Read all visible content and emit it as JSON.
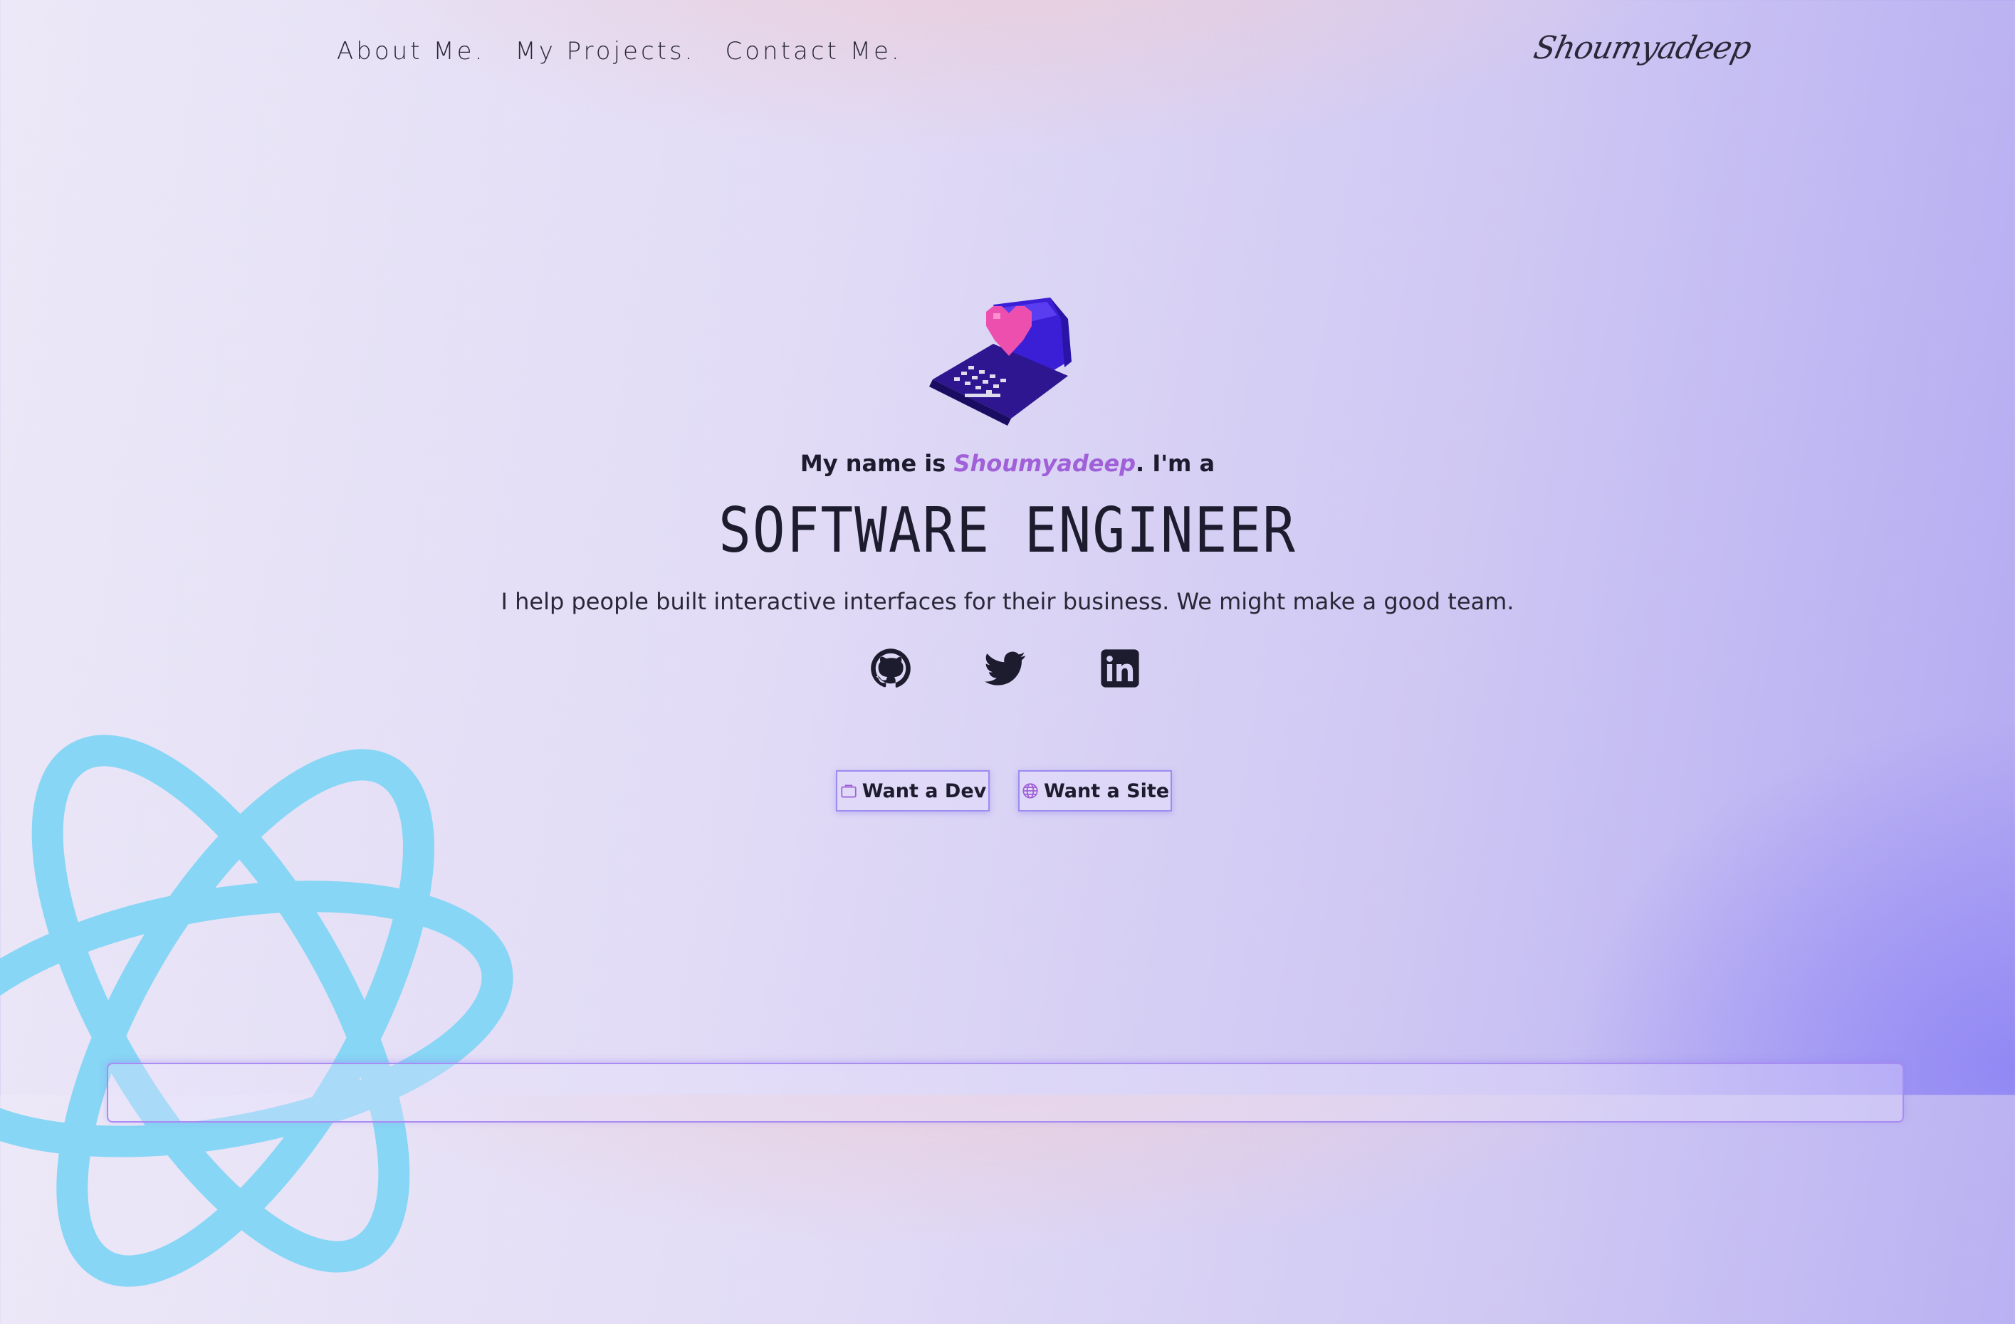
{
  "nav": {
    "items": [
      {
        "label": "About Me."
      },
      {
        "label": "My Projects."
      },
      {
        "label": "Contact Me."
      }
    ],
    "signature": "Shoumyadeep"
  },
  "hero": {
    "intro_prefix": "My name is ",
    "name": "Shoumyadeep",
    "intro_suffix": ". I'm a",
    "role": "SOFTWARE ENGINEER",
    "tagline": "I help people built interactive interfaces for their business. We might make a good team."
  },
  "socials": [
    {
      "icon": "github-icon"
    },
    {
      "icon": "twitter-icon"
    },
    {
      "icon": "linkedin-icon"
    }
  ],
  "buttons": {
    "dev_label": "Want a Dev",
    "site_label": "Want a Site"
  },
  "colors": {
    "accent": "#a060d8",
    "react_blue": "#87d6f5",
    "button_border": "#9b8cef"
  }
}
